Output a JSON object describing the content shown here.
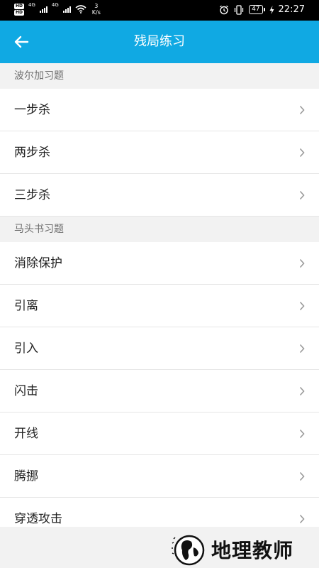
{
  "status_bar": {
    "hd_top": "HD",
    "hd_bottom": "HD",
    "net1": "4G",
    "net2": "4G",
    "speed_value": "3",
    "speed_unit": "K/s",
    "battery": "47",
    "time": "22:27"
  },
  "app_bar": {
    "title": "残局练习"
  },
  "sections": [
    {
      "header": "波尔加习题",
      "items": [
        "一步杀",
        "两步杀",
        "三步杀"
      ]
    },
    {
      "header": "马头书习题",
      "items": [
        "消除保护",
        "引离",
        "引入",
        "闪击",
        "开线",
        "腾挪",
        "穿透攻击"
      ]
    }
  ],
  "watermark": {
    "text": "地理教师"
  },
  "colors": {
    "app_bar": "#10a9e3",
    "background": "#f2f2f2",
    "row": "#ffffff",
    "chevron": "#9a9a9a"
  }
}
